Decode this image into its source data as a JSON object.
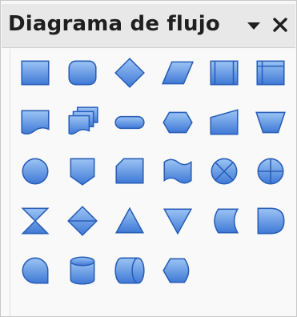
{
  "panel": {
    "title": "Diagrama de flujo",
    "menu_icon": "dropdown-triangle-icon",
    "close_icon": "close-icon"
  },
  "colors": {
    "shape_fill_light": "#9cc4f4",
    "shape_fill_dark": "#3f79d6",
    "shape_stroke": "#2a5fb8",
    "titlebar_bg": "#e8e8e8",
    "content_bg": "#f9f9f9"
  },
  "shapes": [
    [
      "flowchart-process",
      "flowchart-alternate-process",
      "flowchart-decision",
      "flowchart-data",
      "flowchart-predefined-process",
      "flowchart-internal-storage"
    ],
    [
      "flowchart-document",
      "flowchart-multidocument",
      "flowchart-terminator",
      "flowchart-preparation",
      "flowchart-manual-input",
      "flowchart-manual-operation"
    ],
    [
      "flowchart-connector",
      "flowchart-off-page-connector",
      "flowchart-card",
      "flowchart-punched-tape",
      "flowchart-summing-junction",
      "flowchart-or"
    ],
    [
      "flowchart-collate",
      "flowchart-sort",
      "flowchart-extract",
      "flowchart-merge",
      "flowchart-stored-data",
      "flowchart-delay"
    ],
    [
      "flowchart-sequential-access",
      "flowchart-magnetic-disc",
      "flowchart-direct-access-storage",
      "flowchart-display"
    ]
  ]
}
